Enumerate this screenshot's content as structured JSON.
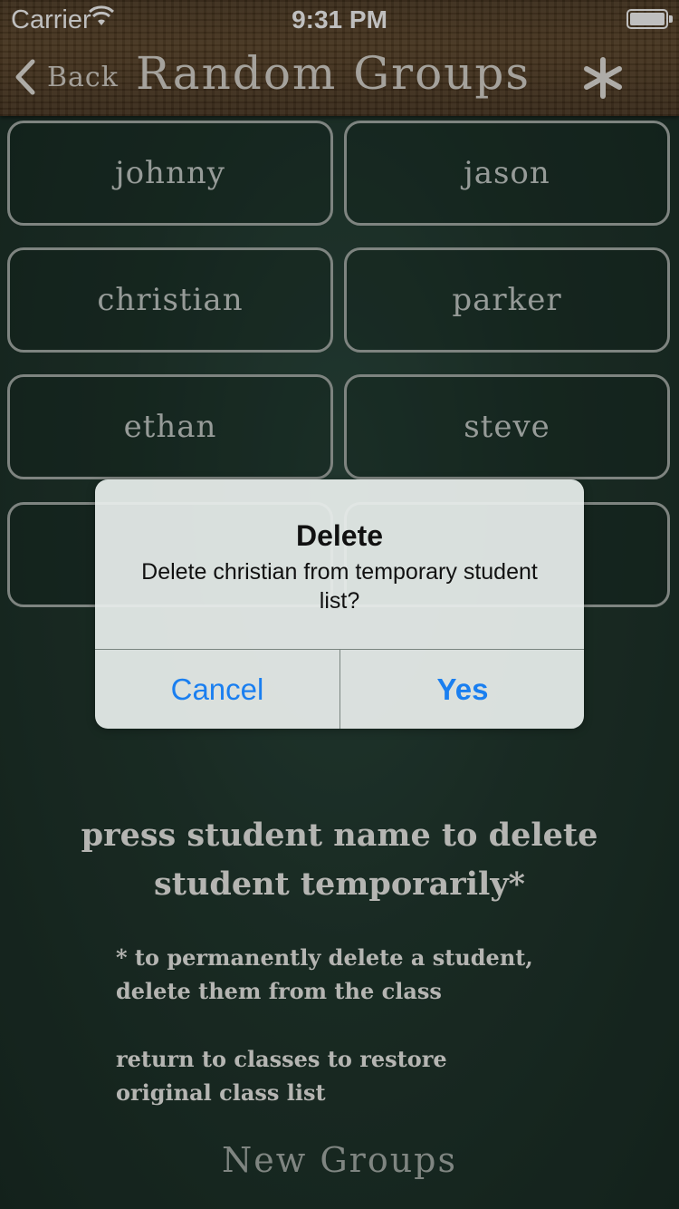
{
  "status_bar": {
    "carrier": "Carrier",
    "time": "9:31 PM"
  },
  "nav": {
    "back_label": "Back",
    "title": "Random Groups",
    "action_icon": "asterisk-icon"
  },
  "students": [
    "johnny",
    "jason",
    "christian",
    "parker",
    "ethan",
    "steve",
    "",
    ""
  ],
  "alert": {
    "title": "Delete",
    "message": "Delete christian from temporary student list?",
    "cancel_label": "Cancel",
    "confirm_label": "Yes"
  },
  "instructions": {
    "heading_line1": "press student name to delete",
    "heading_line2": "student temporarily*",
    "note1_line1": "* to permanently delete a student,",
    "note1_line2": "delete them from the class",
    "note2_line1": "return to classes to restore",
    "note2_line2": "original class list"
  },
  "footer": {
    "new_groups_label": "New Groups"
  },
  "colors": {
    "accent": "#1a7ff0",
    "chalkboard": "#22392f",
    "wood": "#5c4427"
  }
}
